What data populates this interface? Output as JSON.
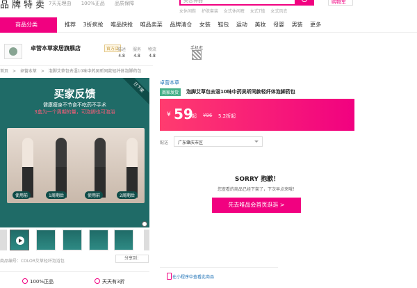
{
  "header": {
    "brand": "品牌特卖",
    "top_icons": [
      "7天无理由",
      "100%正品",
      "品质保障"
    ],
    "search_placeholder": "美容神器",
    "cart_label": "购物车",
    "hot_words": [
      "女休闲鞋",
      "护肤套装",
      "女式休闲裤",
      "女式T恤",
      "女式风衣"
    ]
  },
  "nav": {
    "category_button": "商品分类",
    "links": [
      "推荐",
      "3折疯抢",
      "唯品快抢",
      "唯品卖菜",
      "品牌清仓",
      "女装",
      "鞋包",
      "运动",
      "美妆",
      "母婴",
      "男装",
      "更多"
    ]
  },
  "shop": {
    "name": "卓营本草家居旗舰店",
    "badge": "官方店",
    "scores": [
      {
        "label": "描述",
        "value": "4.8"
      },
      {
        "label": "服务",
        "value": "4.8"
      },
      {
        "label": "物流",
        "value": "4.8"
      }
    ],
    "mobile_label": "手机逛"
  },
  "breadcrumb": [
    "首页",
    ">",
    "卓营本草",
    ">",
    "泡脚艾草包去湿10味中药吴昕同款轻纤体泡脚药包"
  ],
  "main_image": {
    "badge": "已下架",
    "headline": "买家反馈",
    "sub1": "健康瘦身不节食不吃药不手术",
    "sub2": "3盒为一个周期的量，可泡脚也可泡浴",
    "tags": [
      "使用前",
      "1周期后",
      "使用前",
      "2周期后"
    ]
  },
  "goods_no": "商品编号：COLOR艾草轻纤泡浴包",
  "share_label": "分享到：",
  "guarantees": [
    "100%正品",
    "天天有3折"
  ],
  "product": {
    "brand": "卓营本草",
    "sale_tag": "商家发货",
    "title": "泡脚艾草包去湿10味中药吴昕同款轻纤体泡脚药包",
    "currency": "¥",
    "price": "59",
    "price_suffix": "起",
    "original_price": "¥96",
    "discount": "5.2折起"
  },
  "shipping": {
    "label": "配送",
    "value": "广东肇庆市区"
  },
  "soldout": {
    "title": "SORRY 抱歉！",
    "message": "您查看的商品已经下架了，下次早点来哦！",
    "button": "先去唯品会首页逛逛 >"
  },
  "mini_program_link": "在小程序中查看此商品"
}
